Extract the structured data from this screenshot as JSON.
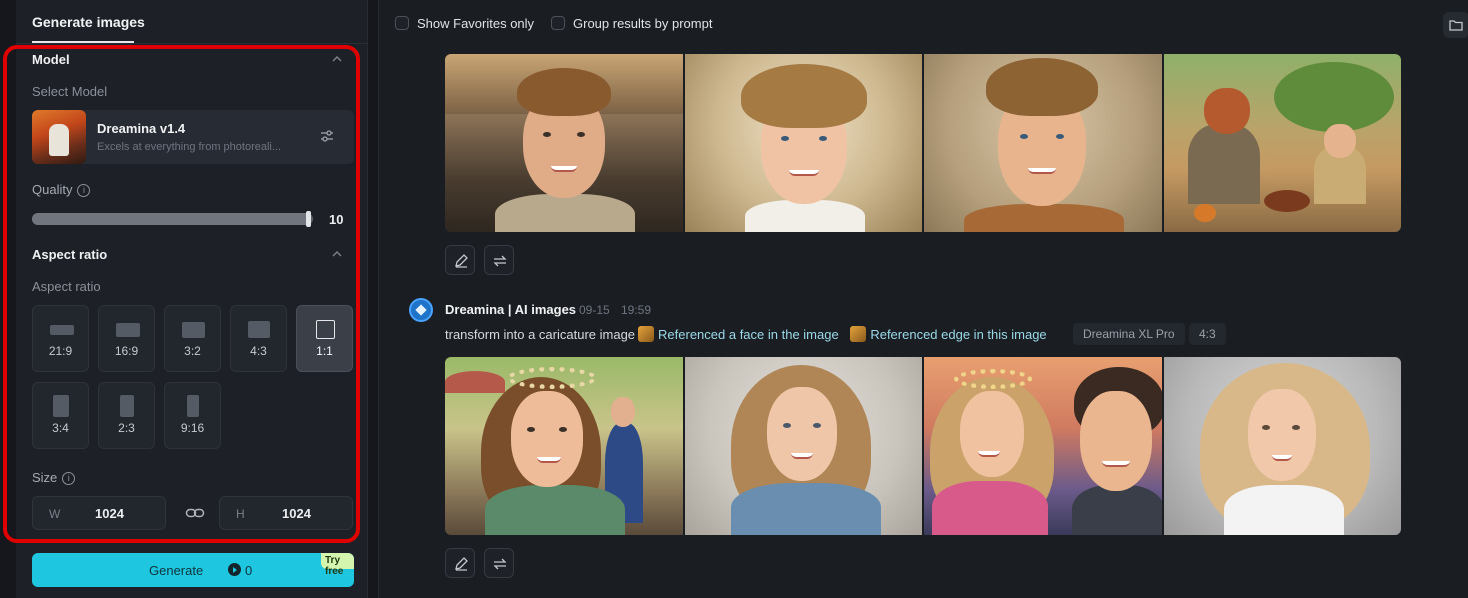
{
  "left_panel": {
    "tab": "Generate images",
    "model_section": {
      "title": "Model",
      "select_label": "Select Model",
      "model_name": "Dreamina v1.4",
      "model_desc": "Excels at everything from photoreali..."
    },
    "quality": {
      "label": "Quality",
      "value": "10",
      "fraction": 0.99
    },
    "aspect_section": {
      "title": "Aspect ratio",
      "sub_label": "Aspect ratio",
      "options": [
        "21:9",
        "16:9",
        "3:2",
        "4:3",
        "1:1",
        "3:4",
        "2:3",
        "9:16"
      ],
      "selected": "1:1"
    },
    "size": {
      "label": "Size",
      "w_prefix": "W",
      "w_value": "1024",
      "h_prefix": "H",
      "h_value": "1024"
    },
    "generate": {
      "label": "Generate",
      "count": "0",
      "badge": "Try free"
    }
  },
  "right_panel": {
    "toolbar": {
      "favorites_label": "Show Favorites only",
      "group_label": "Group results by prompt"
    },
    "result2": {
      "author": "Dreamina | AI images",
      "date": "09-15",
      "time": "19:59",
      "prompt": "transform into a caricature image",
      "ref1": "Referenced a face in the image",
      "ref2": "Referenced edge in this image",
      "model_tag": "Dreamina XL Pro",
      "ratio_tag": "4:3"
    }
  },
  "colors": {
    "accent": "#1fc6e0",
    "highlight_frame": "#e00000",
    "try_free_badge": "#d3f5ad"
  },
  "icons": [
    "info-icon",
    "chevron-up-icon",
    "settings-sliders-icon",
    "link-icon",
    "folder-icon",
    "edit-icon",
    "regenerate-icon",
    "coin-icon"
  ]
}
